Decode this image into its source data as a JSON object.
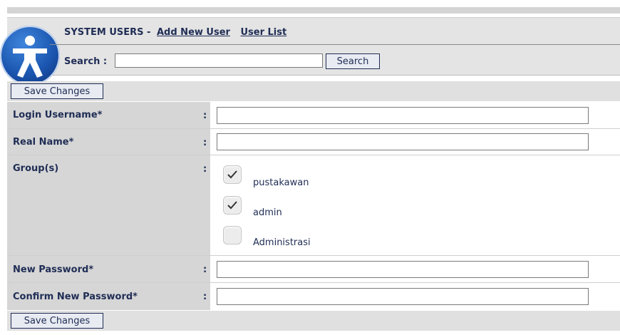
{
  "header": {
    "title": "SYSTEM USERS - ",
    "add_new_user_link": "Add New User",
    "user_list_link": "User List",
    "search_label": "Search :",
    "search_value": "",
    "search_button": "Search"
  },
  "buttons": {
    "save_changes_top": "Save Changes",
    "save_changes_bottom": "Save Changes"
  },
  "form": {
    "colon": ":",
    "login_username_label": "Login Username*",
    "real_name_label": "Real Name*",
    "groups_label": "Group(s)",
    "new_password_label": "New Password*",
    "confirm_password_label": "Confirm New Password*",
    "login_username_value": "",
    "real_name_value": "",
    "new_password_value": "",
    "confirm_password_value": "",
    "groups": [
      {
        "label": "pustakawan",
        "checked": true
      },
      {
        "label": "admin",
        "checked": true
      },
      {
        "label": "Administrasi",
        "checked": false
      }
    ]
  },
  "colors": {
    "text": "#1f2d55",
    "label_bg": "#d6d6d6",
    "header_bg": "#e4e4e4",
    "logo": "#1b56b0"
  },
  "icons": {
    "logo": "accessibility-person-icon",
    "checkmark": "checkmark-icon"
  }
}
